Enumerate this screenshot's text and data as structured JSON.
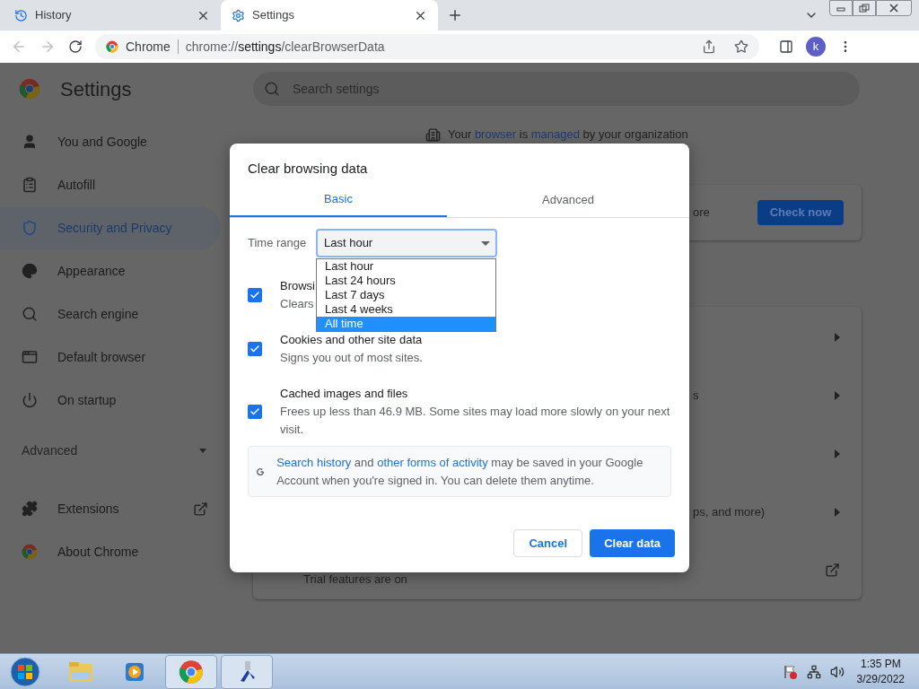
{
  "browser": {
    "tabs": [
      {
        "title": "History",
        "selected": false
      },
      {
        "title": "Settings",
        "selected": true
      }
    ],
    "omnibox": {
      "site": "Chrome",
      "url_scheme": "chrome://",
      "url_host": "settings",
      "url_path": "/clearBrowserData"
    },
    "profile_initial": "k"
  },
  "settings": {
    "title": "Settings",
    "search_placeholder": "Search settings",
    "sidebar": [
      {
        "label": "You and Google",
        "selected": false
      },
      {
        "label": "Autofill",
        "selected": false
      },
      {
        "label": "Security and Privacy",
        "selected": true
      },
      {
        "label": "Appearance",
        "selected": false
      },
      {
        "label": "Search engine",
        "selected": false
      },
      {
        "label": "Default browser",
        "selected": false
      },
      {
        "label": "On startup",
        "selected": false
      }
    ],
    "advanced_label": "Advanced",
    "sidebar_extra": [
      {
        "label": "Extensions",
        "external": true
      },
      {
        "label": "About Chrome",
        "external": false
      }
    ],
    "managed_notice": [
      {
        "text": "Your ",
        "link": false
      },
      {
        "text": "browser",
        "link": true
      },
      {
        "text": " is ",
        "link": false
      },
      {
        "text": "managed",
        "link": true
      },
      {
        "text": " by your organization",
        "link": false
      }
    ],
    "safety_card": {
      "text_fragment": "ore",
      "button": "Check now"
    },
    "privacy_rows": [
      {
        "fragment": "",
        "kind": "arrow"
      },
      {
        "fragment": "s",
        "kind": "arrow"
      },
      {
        "fragment": "",
        "kind": "arrow"
      },
      {
        "fragment": "ps, and more)",
        "kind": "arrow"
      },
      {
        "fragment": "Trial features are on",
        "kind": "external"
      }
    ]
  },
  "dialog": {
    "title": "Clear browsing data",
    "tabs": [
      {
        "label": "Basic",
        "selected": true
      },
      {
        "label": "Advanced",
        "selected": false
      }
    ],
    "time_range": {
      "label": "Time range",
      "value": "Last hour",
      "options": [
        {
          "label": "Last hour",
          "highlighted": false
        },
        {
          "label": "Last 24 hours",
          "highlighted": false
        },
        {
          "label": "Last 7 days",
          "highlighted": false
        },
        {
          "label": "Last 4 weeks",
          "highlighted": false
        },
        {
          "label": "All time",
          "highlighted": true
        }
      ]
    },
    "items": [
      {
        "title": "Browsi",
        "description": "Clears",
        "checked": true
      },
      {
        "title": "Cookies and other site data",
        "description": "Signs you out of most sites.",
        "checked": true
      },
      {
        "title": "Cached images and files",
        "description": "Frees up less than 46.9 MB. Some sites may load more slowly on your next visit.",
        "checked": true
      }
    ],
    "info": [
      {
        "text": "Search history",
        "link": true
      },
      {
        "text": " and ",
        "link": false
      },
      {
        "text": "other forms of activity",
        "link": true
      },
      {
        "text": " may be saved in your Google Account when you're signed in. You can delete them anytime.",
        "link": false
      }
    ],
    "buttons": [
      {
        "label": "Cancel",
        "kind": "secondary"
      },
      {
        "label": "Clear data",
        "kind": "primary"
      }
    ]
  },
  "taskbar": {
    "time": "1:35 PM",
    "date": "3/29/2022"
  }
}
